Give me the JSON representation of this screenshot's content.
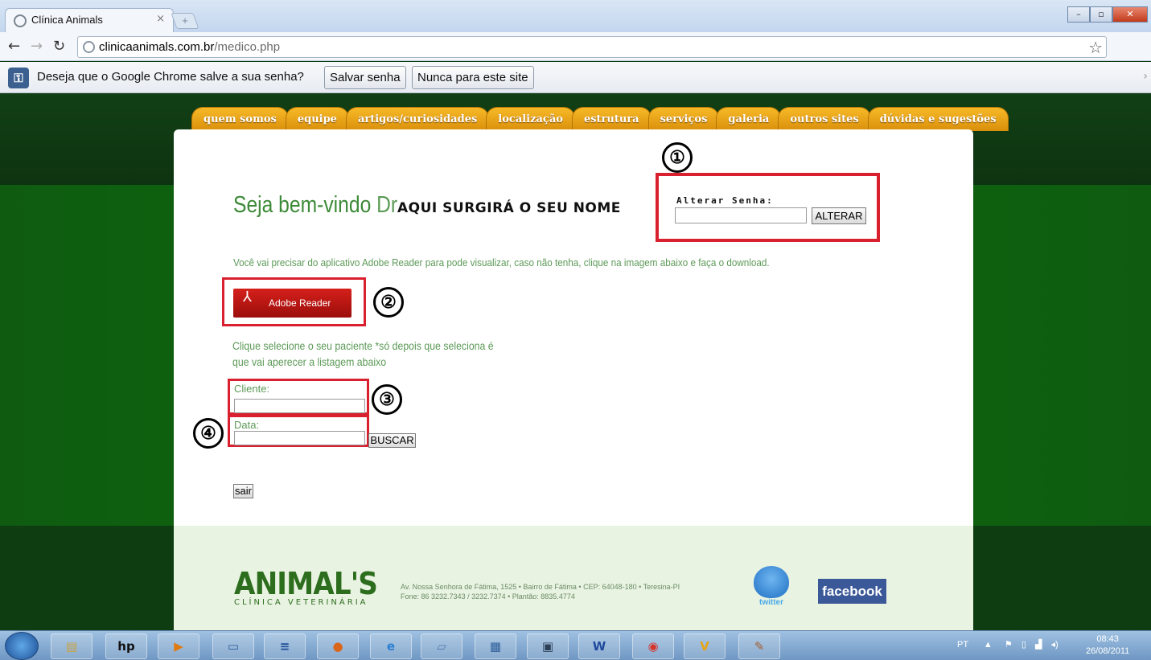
{
  "browser": {
    "tab_title": "Clínica Animals",
    "url_host": "clinicaanimals.com.br",
    "url_path": "/medico.php",
    "infobar": {
      "message": "Deseja que o Google Chrome salve a sua senha?",
      "save_label": "Salvar senha",
      "never_label": "Nunca para este site"
    }
  },
  "site": {
    "menu": [
      "quem somos",
      "equipe",
      "artigos/curiosidades",
      "localização",
      "estrutura",
      "serviços",
      "galeria",
      "outros sites",
      "dúvidas e sugestões"
    ],
    "welcome": "Seja bem-vindo",
    "welcome_dr": "Dr.",
    "your_name": "AQUI SURGIRÁ O SEU NOME",
    "change_password_label": "Alterar Senha:",
    "change_password_button": "ALTERAR",
    "adobe_note": "Você vai precisar do aplicativo Adobe Reader para pode visualizar, caso não tenha, clique na imagem abaixo e faça o download.",
    "adobe_button": "Adobe Reader",
    "select_note": "Clique selecione o seu paciente *só depois que seleciona é que vai aperecer a listagem abaixo",
    "client_label": "Cliente:",
    "date_label": "Data:",
    "search_button": "BUSCAR",
    "logout_button": "sair",
    "badges": [
      "①",
      "②",
      "③",
      "④"
    ],
    "footer": {
      "logo_big": "ANIMAL'S",
      "logo_small": "CLÍNICA VETERINÁRIA",
      "address_line1": "Av. Nossa Senhora de Fátima, 1525 • Bairro de Fátima • CEP: 64048-180 • Teresina-PI",
      "address_line2": "Fone: 86 3232.7343 / 3232.7374 • Plantão: 8835.4774",
      "twitter": "twitter",
      "facebook": "facebook"
    }
  },
  "taskbar": {
    "lang": "PT",
    "time": "08:43",
    "date": "26/08/2011"
  },
  "colors": {
    "highlight_red": "#d9202e",
    "menu_orange": "#f2a51a",
    "text_green": "#5c9a57"
  }
}
